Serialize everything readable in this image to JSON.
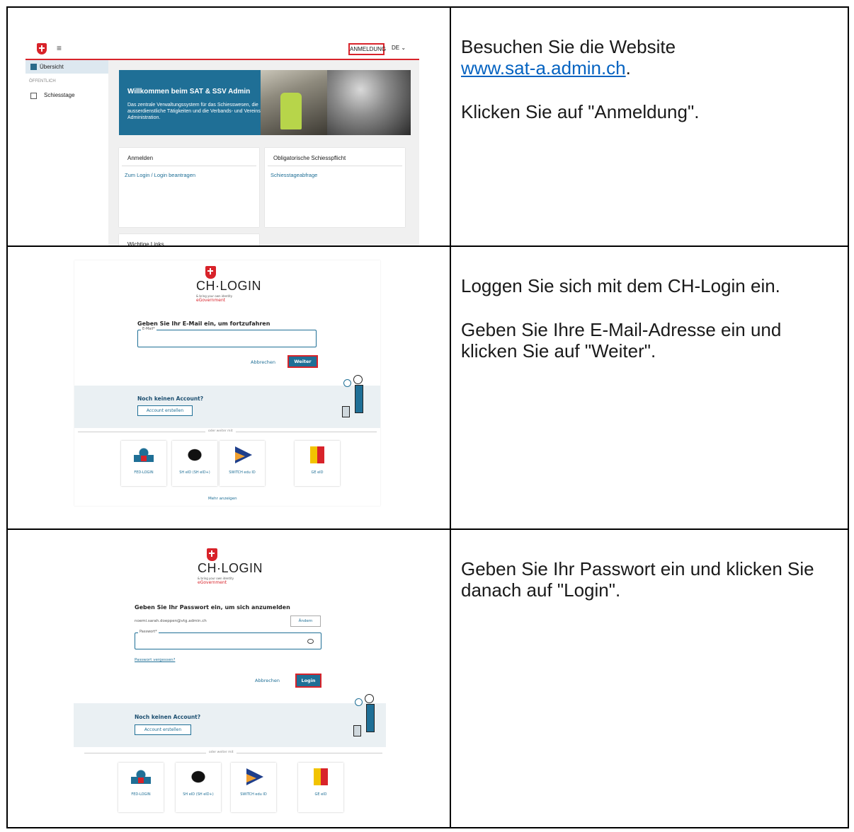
{
  "row1": {
    "screenshot": {
      "menu_icon": "hamburger-icon",
      "login_button": "ANMELDUNG",
      "language": "DE",
      "sidebar": {
        "active_item": "Übersicht",
        "section_label": "ÖFFENTLICH",
        "items": [
          "Schiesstage"
        ]
      },
      "hero": {
        "title": "Willkommen beim SAT & SSV Admin",
        "text": "Das zentrale Verwaltungssystem für das Schiesswesen, die ausserdienstliche Tätigkeiten und die Verbands- und Vereins- Administration."
      },
      "cards": [
        {
          "heading": "Anmelden",
          "link": "Zum Login / Login beantragen"
        },
        {
          "heading": "Obligatorische Schiesspflicht",
          "link": "Schiesstageabfrage"
        },
        {
          "heading": "Wichtige Links",
          "link": ""
        }
      ]
    },
    "instruction": {
      "line1_prefix": "Besuchen Sie die Website",
      "link": "www.sat-a.admin.ch",
      "line1_suffix": ".",
      "line2": "Klicken Sie auf \"Anmeldung\"."
    }
  },
  "row2": {
    "screenshot": {
      "logo_name": "CH·LOGIN",
      "logo_tagline": "& bring your own identity",
      "logo_egov": "eGovernment",
      "prompt": "Geben Sie Ihr E-Mail ein, um fortzufahren",
      "email_label": "E-Mail*",
      "cancel": "Abbrechen",
      "next": "Weiter",
      "no_account": "Noch keinen Account?",
      "create_account": "Account erstellen",
      "separator": "oder weiter mit",
      "providers": [
        "FED-LOGIN",
        "SH eID (SH eID+)",
        "SWITCH edu ID",
        "GE eID"
      ],
      "more": "Mehr anzeigen"
    },
    "instruction": {
      "p1": "Loggen Sie sich mit dem CH-Login ein.",
      "p2": "Geben Sie Ihre E-Mail-Adresse ein und klicken Sie auf \"Weiter\"."
    }
  },
  "row3": {
    "screenshot": {
      "logo_name": "CH·LOGIN",
      "logo_tagline": "& bring your own identity",
      "logo_egov": "eGovernment",
      "prompt": "Geben Sie Ihr Passwort ein, um sich anzumelden",
      "email": "noemi.sarah.doeppen@vtg.admin.ch",
      "change": "Ändern",
      "password_label": "Passwort*",
      "forgot": "Passwort vergessen?",
      "cancel": "Abbrechen",
      "login": "Login",
      "no_account": "Noch keinen Account?",
      "create_account": "Account erstellen",
      "separator": "oder weiter mit",
      "providers": [
        "FED-LOGIN",
        "SH eID (SH eID+)",
        "SWITCH edu ID",
        "GE eID"
      ]
    },
    "instruction": {
      "p1": "Geben Sie Ihr Passwort ein und klicken Sie danach auf \"Login\"."
    }
  },
  "colors": {
    "accent": "#1f6f96",
    "swiss_red": "#d8232a",
    "link": "#0563c1"
  }
}
